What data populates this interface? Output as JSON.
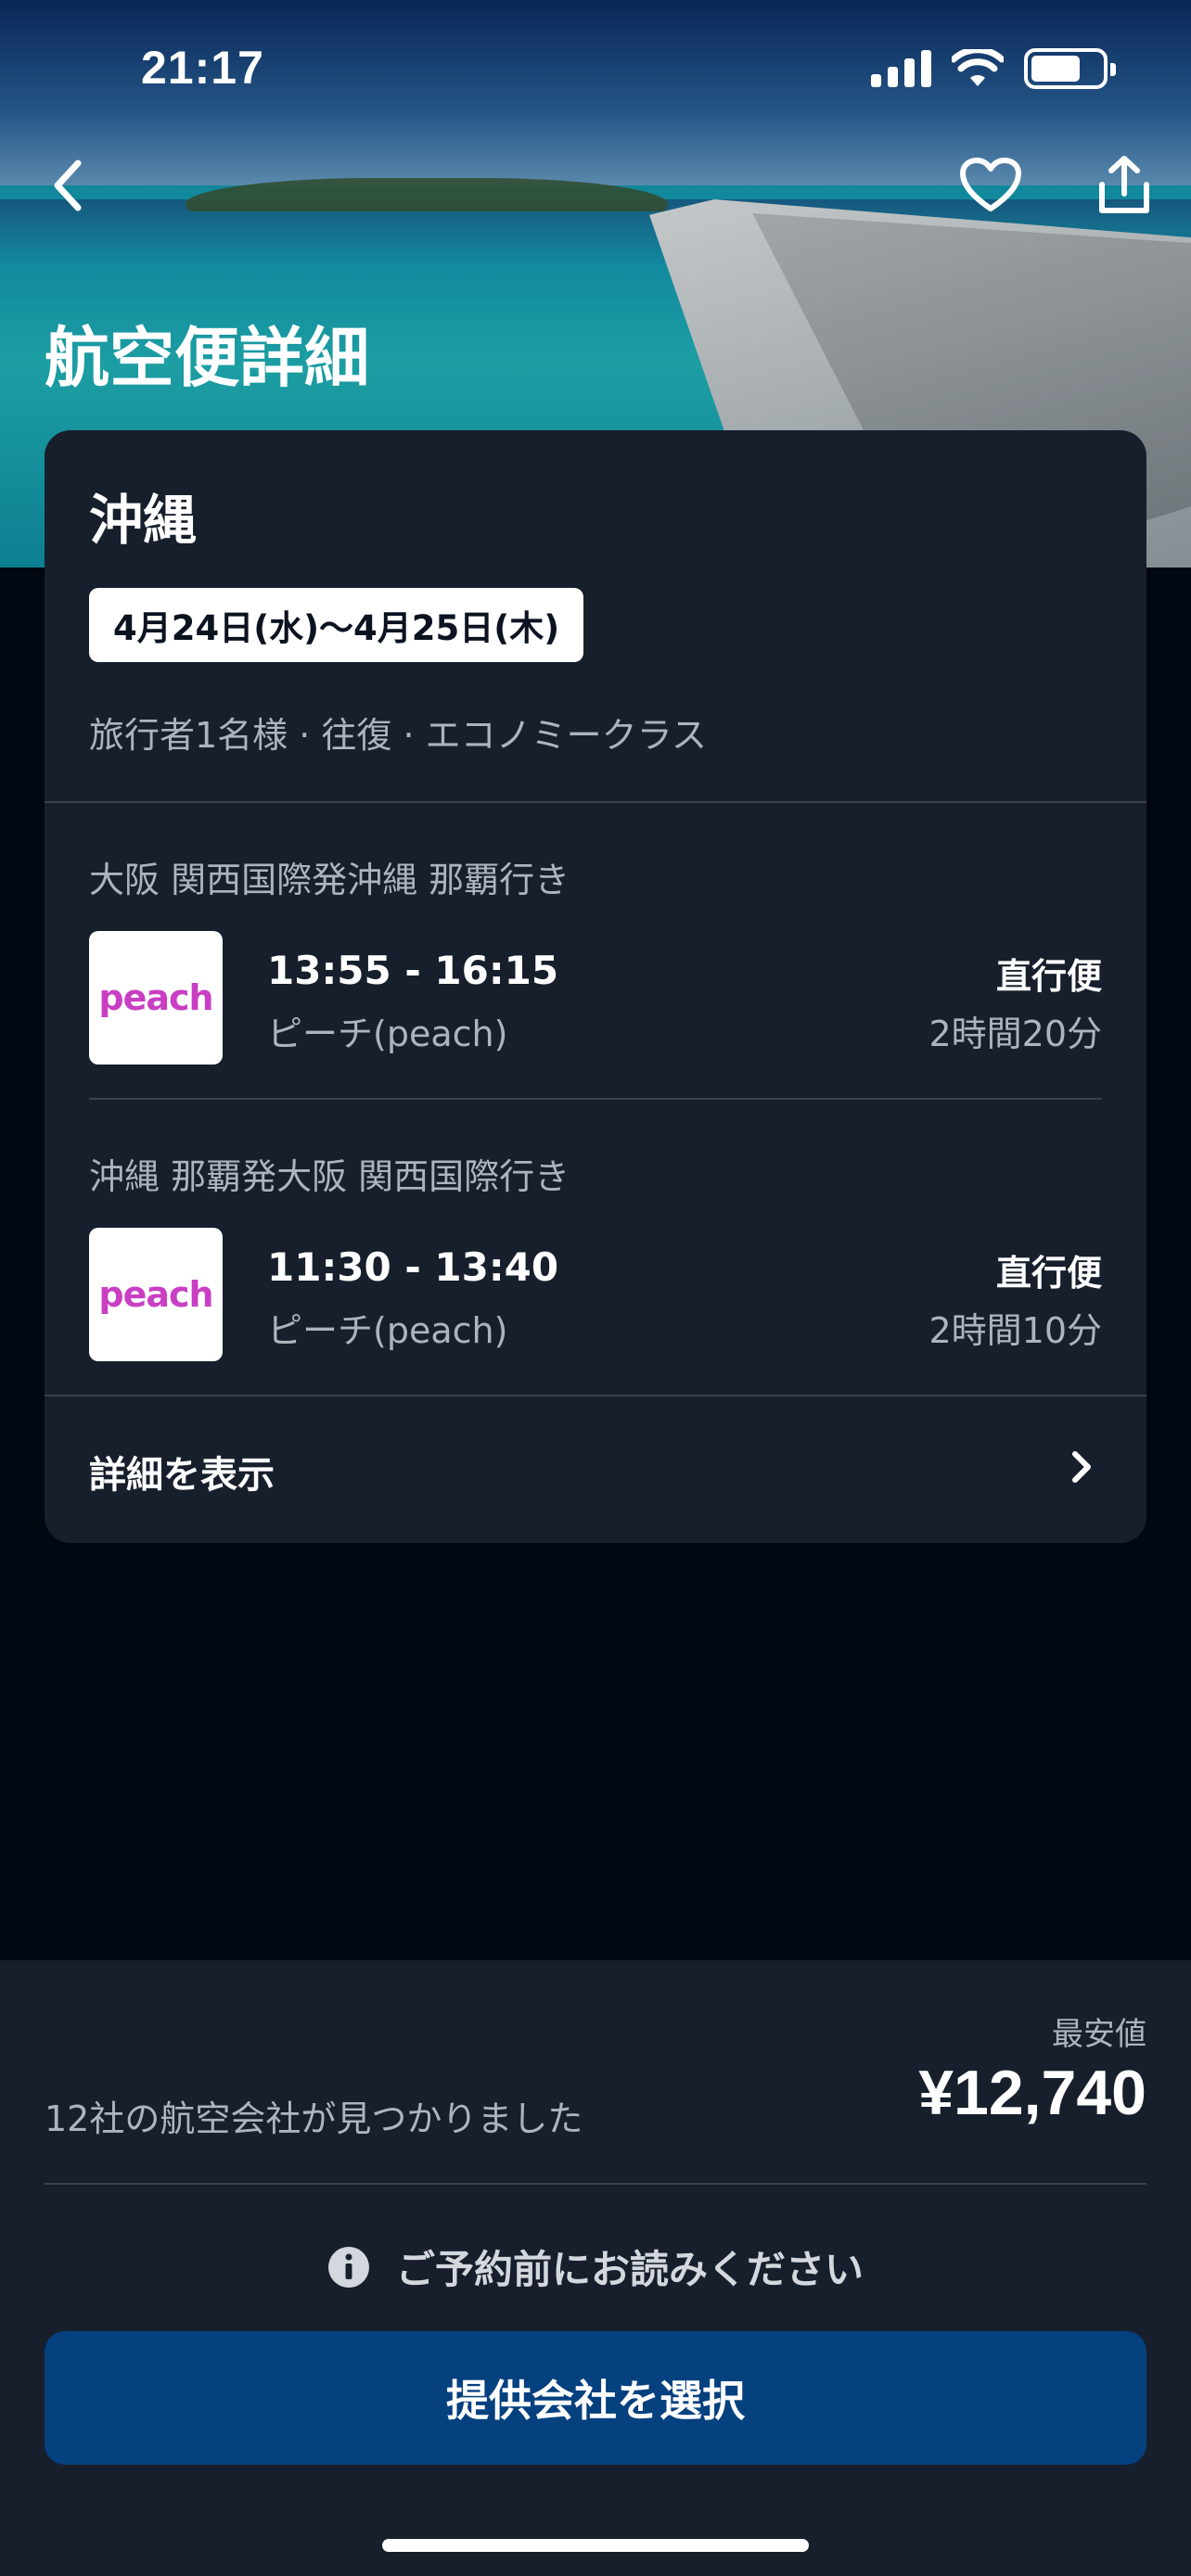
{
  "status_bar": {
    "time": "21:17",
    "battery_level": 0.7
  },
  "nav": {
    "back_icon": "chevron-left-icon",
    "favorite_icon": "heart-icon",
    "share_icon": "share-icon"
  },
  "page": {
    "title": "航空便詳細"
  },
  "card": {
    "destination": "沖縄",
    "dates": "4月24日(水)〜4月25日(木)",
    "trip_meta": "旅行者1名様 · 往復 · エコノミークラス",
    "flights": [
      {
        "route": "大阪 関西国際発沖縄 那覇行き",
        "logo_text": "peach",
        "times": "13:55 - 16:15",
        "airline": "ピーチ(peach)",
        "stops": "直行便",
        "duration": "2時間20分"
      },
      {
        "route": "沖縄 那覇発大阪 関西国際行き",
        "logo_text": "peach",
        "times": "11:30 - 13:40",
        "airline": "ピーチ(peach)",
        "stops": "直行便",
        "duration": "2時間10分"
      }
    ],
    "details_label": "詳細を表示"
  },
  "bottom": {
    "found_text": "12社の航空会社が見つかりました",
    "lowest_label": "最安値",
    "price": "¥12,740",
    "notice": "ご予約前にお読みください",
    "cta_label": "提供会社を選択"
  },
  "colors": {
    "background": "#020811",
    "card": "#171f2c",
    "cta": "#05407f",
    "peach_brand": "#c93fc3"
  }
}
